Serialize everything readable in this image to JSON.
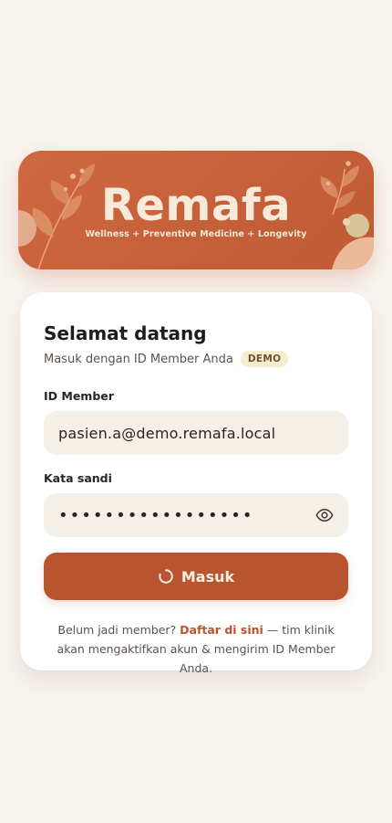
{
  "brand": {
    "name": "Remafa",
    "tagline": "Wellness + Preventive Medicine + Longevity"
  },
  "login": {
    "title": "Selamat datang",
    "subtitle": "Masuk dengan ID Member Anda",
    "badge": "DEMO",
    "member_id_label": "ID Member",
    "member_id_value": "pasien.a@demo.remafa.local",
    "password_label": "Kata sandi",
    "password_value": "•••••••••••••••••",
    "submit_label": "Masuk",
    "footer_prefix": "Belum jadi member? ",
    "footer_link": "Daftar di sini",
    "footer_suffix": " — tim klinik akan mengaktifkan akun & mengirim ID Member Anda."
  },
  "icons": {
    "password_toggle": "eye-icon",
    "loading": "spinner-icon"
  },
  "colors": {
    "background": "#f8f4ef",
    "banner": "#c5603a",
    "brand_text": "#f7ead8",
    "accent": "#b8542e",
    "input_bg": "#f4f0e8",
    "badge_bg": "#f6edcf"
  }
}
